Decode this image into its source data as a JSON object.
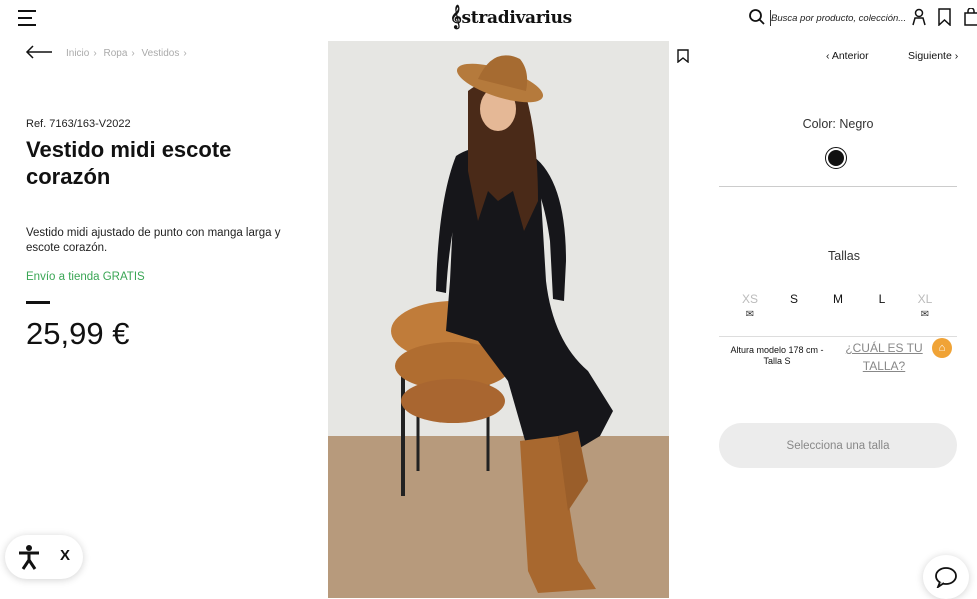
{
  "header": {
    "logo": "stradivarius",
    "search_placeholder": "Busca por producto, colección..."
  },
  "breadcrumb": [
    "Inicio",
    "Ropa",
    "Vestidos"
  ],
  "product": {
    "ref": "Ref. 7163/163-V2022",
    "title": "Vestido midi escote corazón",
    "description": "Vestido midi ajustado de punto con manga larga y escote corazón.",
    "shipping": "Envío a tienda GRATIS",
    "price": "25,99 €"
  },
  "nav": {
    "prev": "Anterior",
    "next": "Siguiente"
  },
  "color": {
    "label": "Color: Negro",
    "swatch": "#111111"
  },
  "sizes": {
    "label": "Tallas",
    "items": [
      {
        "name": "XS",
        "available": false
      },
      {
        "name": "S",
        "available": true
      },
      {
        "name": "M",
        "available": true
      },
      {
        "name": "L",
        "available": true
      },
      {
        "name": "XL",
        "available": false
      }
    ],
    "model_info": "Altura modelo 178 cm - Talla S",
    "which_size": "¿CUÁL ES TU TALLA?"
  },
  "cta": "Selecciona una talla",
  "accessibility": {
    "close": "X"
  },
  "colors": {
    "accent_green": "#3aa655",
    "hanger_orange": "#f0a336"
  }
}
